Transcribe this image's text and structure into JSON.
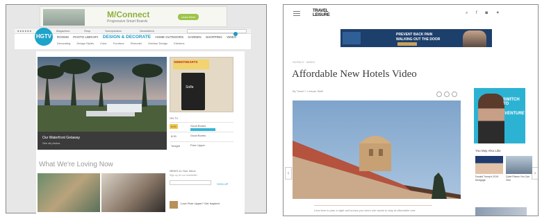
{
  "left": {
    "ad": {
      "brand": "M/Connect",
      "tagline": "Progressive Smart Boards",
      "cta": "Learn More"
    },
    "util_bar": {
      "items": [
        "Magazines",
        "Shop",
        "Sweepstakes",
        "Newsletters"
      ],
      "search_placeholder": "Search"
    },
    "logo_text": "HGTV",
    "nav_main": [
      "ROOMS",
      "PHOTO LIBRARY",
      "DESIGN & DECORATE",
      "HOME OUTDOORS",
      "GARDEN",
      "SHOPPING",
      "VIDEO"
    ],
    "nav_active": "DESIGN & DECORATE",
    "nav_sub": [
      "Decorating",
      "Design Styles",
      "Color",
      "Furniture",
      "Remodel",
      "Outdoor Design",
      "Kitchens"
    ],
    "hero": {
      "title": "Our Waterfront Getaway",
      "subtitle": "See all photos"
    },
    "section_title": "What We're Loving Now",
    "side_ad": {
      "header": "SWEETHEARTS",
      "product": "Sofia"
    },
    "schedule": {
      "title": "ON TV",
      "rows": [
        {
          "time": "8:00",
          "event": "Good Bones",
          "highlight": true
        },
        {
          "time": "8:30",
          "event": "Good Bones",
          "highlight": false
        },
        {
          "time": "Tonight",
          "event": "Fixer Upper",
          "highlight": false
        }
      ]
    },
    "newsletter": {
      "title": "NEWS on Your Inbox",
      "text": "Sign up for our newsletter",
      "button": "SIGN UP"
    },
    "promo": {
      "title": "Love Fixer Upper? Get Inspired"
    }
  },
  "right": {
    "logo_lines": [
      "TRAVEL",
      "LEISURE"
    ],
    "icons": [
      "search-icon",
      "facebook-icon",
      "instagram-icon",
      "twitter-icon"
    ],
    "ad": {
      "line1": "PREVENT BACK PAIN",
      "line2": "WALKING OUT THE DOOR"
    },
    "kicker": "HOTELS  ·  VIDEO",
    "title": "Affordable New Hotels Video",
    "byline": "By Travel + Leisure Staff",
    "body": "Less time to plan a night and knows you when she wants to stay at affordable new",
    "side_ad": {
      "title": "SWITCH TO",
      "brand": "VENTURE"
    },
    "may_also": "You May Also Like",
    "cards": [
      {
        "title": "Donald Trump's 2019 Mortgage"
      },
      {
        "title": "Quiet Places You Can Visit"
      }
    ]
  }
}
